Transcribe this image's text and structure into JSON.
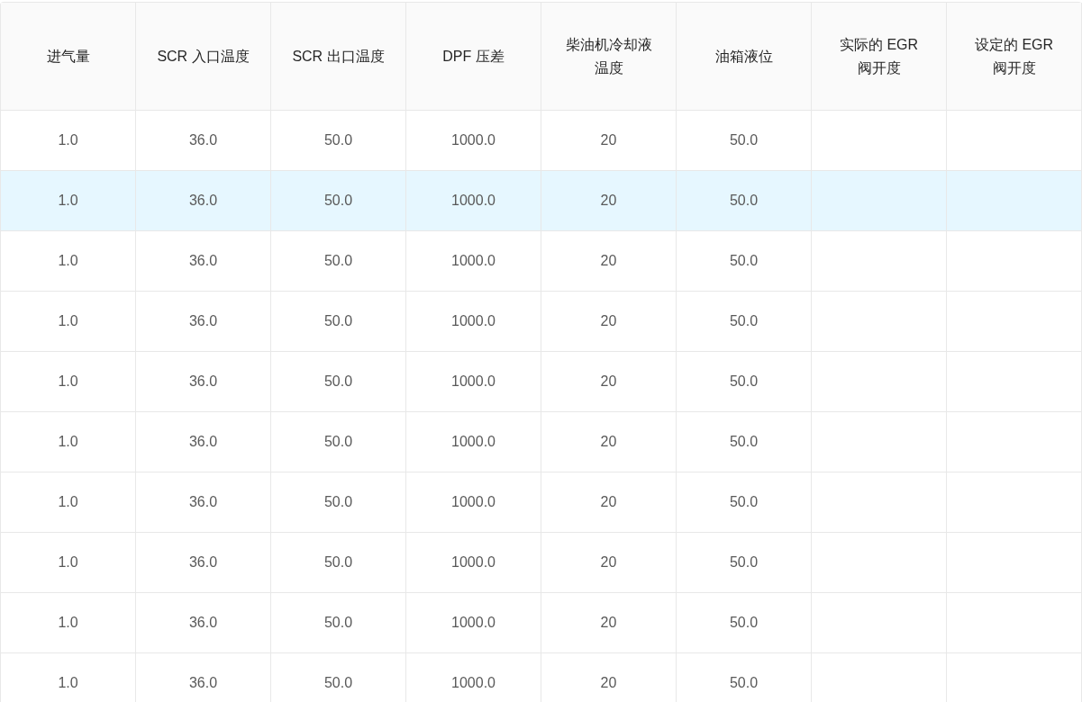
{
  "table": {
    "columns": [
      "进气量",
      "SCR 入口温度",
      "SCR 出口温度",
      "DPF 压差",
      "柴油机冷却液温度",
      "油箱液位",
      "实际的 EGR 阀开度",
      "设定的 EGR 阀开度"
    ],
    "rows": [
      {
        "selected": false,
        "cells": [
          "1.0",
          "36.0",
          "50.0",
          "1000.0",
          "20",
          "50.0"
        ]
      },
      {
        "selected": true,
        "cells": [
          "1.0",
          "36.0",
          "50.0",
          "1000.0",
          "20",
          "50.0"
        ]
      },
      {
        "selected": false,
        "cells": [
          "1.0",
          "36.0",
          "50.0",
          "1000.0",
          "20",
          "50.0"
        ]
      },
      {
        "selected": false,
        "cells": [
          "1.0",
          "36.0",
          "50.0",
          "1000.0",
          "20",
          "50.0"
        ]
      },
      {
        "selected": false,
        "cells": [
          "1.0",
          "36.0",
          "50.0",
          "1000.0",
          "20",
          "50.0"
        ]
      },
      {
        "selected": false,
        "cells": [
          "1.0",
          "36.0",
          "50.0",
          "1000.0",
          "20",
          "50.0"
        ]
      },
      {
        "selected": false,
        "cells": [
          "1.0",
          "36.0",
          "50.0",
          "1000.0",
          "20",
          "50.0"
        ]
      },
      {
        "selected": false,
        "cells": [
          "1.0",
          "36.0",
          "50.0",
          "1000.0",
          "20",
          "50.0"
        ]
      },
      {
        "selected": false,
        "cells": [
          "1.0",
          "36.0",
          "50.0",
          "1000.0",
          "20",
          "50.0"
        ]
      },
      {
        "selected": false,
        "cells": [
          "1.0",
          "36.0",
          "50.0",
          "1000.0",
          "20",
          "50.0"
        ]
      }
    ]
  }
}
